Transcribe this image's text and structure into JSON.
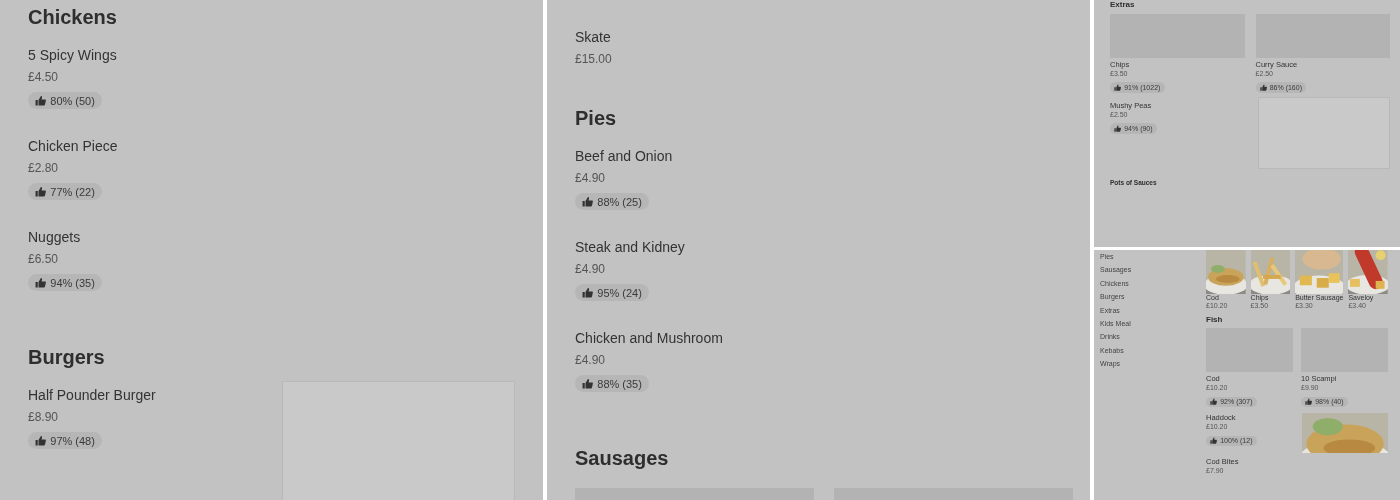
{
  "panels": [
    {
      "sections": [
        {
          "title": "Chickens",
          "items": [
            {
              "kind": "row",
              "name": "5 Spicy Wings",
              "price": "£4.50",
              "rating": "80% (50)"
            },
            {
              "kind": "row",
              "name": "Chicken Piece",
              "price": "£2.80",
              "rating": "77% (22)"
            },
            {
              "kind": "row",
              "name": "Nuggets",
              "price": "£6.50",
              "rating": "94% (35)"
            }
          ]
        },
        {
          "title": "Burgers",
          "items": [
            {
              "kind": "image-row",
              "name": "Half Pounder Burger",
              "price": "£8.90",
              "rating": "97% (48)"
            }
          ]
        }
      ]
    },
    {
      "sections": [
        {
          "items": [
            {
              "kind": "row",
              "name": "Skate",
              "price": "£15.00"
            }
          ]
        },
        {
          "title": "Pies",
          "items": [
            {
              "kind": "row",
              "name": "Beef and Onion",
              "price": "£4.90",
              "rating": "88% (25)"
            },
            {
              "kind": "row",
              "name": "Steak and Kidney",
              "price": "£4.90",
              "rating": "95% (24)"
            },
            {
              "kind": "row",
              "name": "Chicken and Mushroom",
              "price": "£4.90",
              "rating": "88% (35)"
            }
          ]
        },
        {
          "title": "Sausages"
        }
      ]
    }
  ],
  "extras": {
    "title": "Extras",
    "items": [
      {
        "kind": "card",
        "name": "Chips",
        "price": "£3.50",
        "rating": "91% (1022)"
      },
      {
        "kind": "card",
        "name": "Curry Sauce",
        "price": "£2.50",
        "rating": "86% (160)"
      },
      {
        "kind": "image-row",
        "name": "Mushy Peas",
        "price": "£2.50",
        "rating": "94% (90)"
      }
    ],
    "next_title": "Pots of Sauces"
  },
  "overview": {
    "nav": [
      "Pies",
      "Sausages",
      "Chickens",
      "Burgers",
      "Extras",
      "Kids Meal",
      "Drinks",
      "Kebabs",
      "Wraps"
    ],
    "featured": [
      {
        "name": "Cod",
        "price": "£10.20"
      },
      {
        "name": "Chips",
        "price": "£3.50"
      },
      {
        "name": "Butter Sausage",
        "price": "£3.30"
      },
      {
        "name": "Saveloy",
        "price": "£3.40"
      }
    ],
    "section": {
      "title": "Fish",
      "items": [
        {
          "kind": "card",
          "name": "Cod",
          "price": "£10.20",
          "rating": "92% (307)"
        },
        {
          "kind": "card",
          "name": "10 Scampi",
          "price": "£9.90",
          "rating": "98% (40)"
        },
        {
          "kind": "photo-row",
          "name": "Haddock",
          "price": "£10.20",
          "rating": "100% (12)"
        },
        {
          "kind": "row",
          "name": "Cod Bites",
          "price": "£7.90"
        }
      ]
    }
  }
}
